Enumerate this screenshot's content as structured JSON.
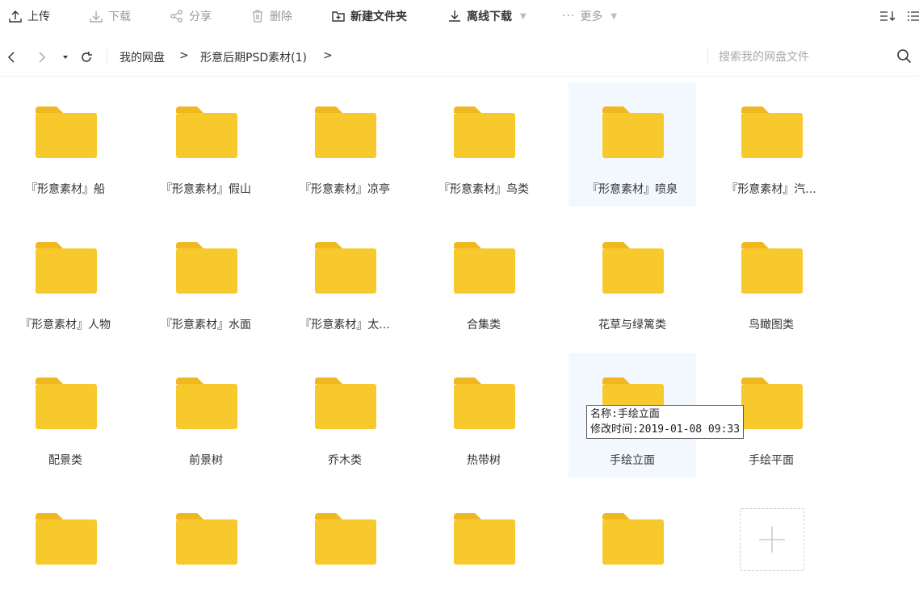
{
  "toolbar": {
    "upload": "上传",
    "download": "下载",
    "share": "分享",
    "delete": "删除",
    "new_folder": "新建文件夹",
    "offline_download": "离线下载",
    "more": "更多"
  },
  "address_bar": {
    "crumbs": [
      "我的网盘",
      "形意后期PSD素材(1)"
    ],
    "separator": ">",
    "search_placeholder": "搜索我的网盘文件"
  },
  "folders": [
    {
      "name": "『形意素材』船"
    },
    {
      "name": "『形意素材』假山"
    },
    {
      "name": "『形意素材』凉亭"
    },
    {
      "name": "『形意素材』鸟类"
    },
    {
      "name": "『形意素材』喷泉",
      "selected": true
    },
    {
      "name": "『形意素材』汽..."
    },
    {
      "name": "『形意素材』人物"
    },
    {
      "name": "『形意素材』水面"
    },
    {
      "name": "『形意素材』太..."
    },
    {
      "name": "合集类"
    },
    {
      "name": "花草与绿篱类"
    },
    {
      "name": "鸟瞰图类"
    },
    {
      "name": "配景类"
    },
    {
      "name": "前景树"
    },
    {
      "name": "乔木类"
    },
    {
      "name": "热带树"
    },
    {
      "name": "手绘立面",
      "selected": true
    },
    {
      "name": "手绘平面"
    },
    {
      "name": ""
    },
    {
      "name": ""
    },
    {
      "name": ""
    },
    {
      "name": ""
    },
    {
      "name": ""
    }
  ],
  "tooltip": {
    "name_line": "名称:手绘立面",
    "time_line": "修改时间:2019-01-08 09:33"
  },
  "colors": {
    "folder_body": "#F8C92C",
    "folder_tab": "#F0B820",
    "selected_bg": "#F2F8FD"
  }
}
